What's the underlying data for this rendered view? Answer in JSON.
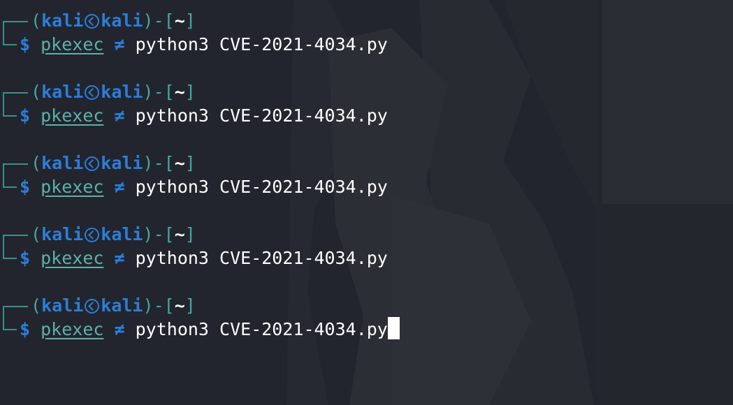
{
  "colors": {
    "background": "#22252e",
    "user_blue": "#2c7ed8",
    "frame_teal": "#46a7a0",
    "command_teal": "#5fb0a8",
    "text_white": "#ffffff"
  },
  "prompt": {
    "open_paren": "(",
    "user": "kali",
    "host": "kali",
    "close_paren": ")",
    "separator": "-",
    "cwd_open": "[",
    "cwd": "~",
    "cwd_close": "]",
    "symbol": "$",
    "icon": "kali-skull-icon"
  },
  "entries": [
    {
      "command": "pkexec",
      "operator": "≠",
      "args": "python3 CVE-2021-4034.py"
    },
    {
      "command": "pkexec",
      "operator": "≠",
      "args": "python3 CVE-2021-4034.py"
    },
    {
      "command": "pkexec",
      "operator": "≠",
      "args": "python3 CVE-2021-4034.py"
    },
    {
      "command": "pkexec",
      "operator": "≠",
      "args": "python3 CVE-2021-4034.py"
    },
    {
      "command": "pkexec",
      "operator": "≠",
      "args": "python3 CVE-2021-4034.py",
      "active": true
    }
  ]
}
